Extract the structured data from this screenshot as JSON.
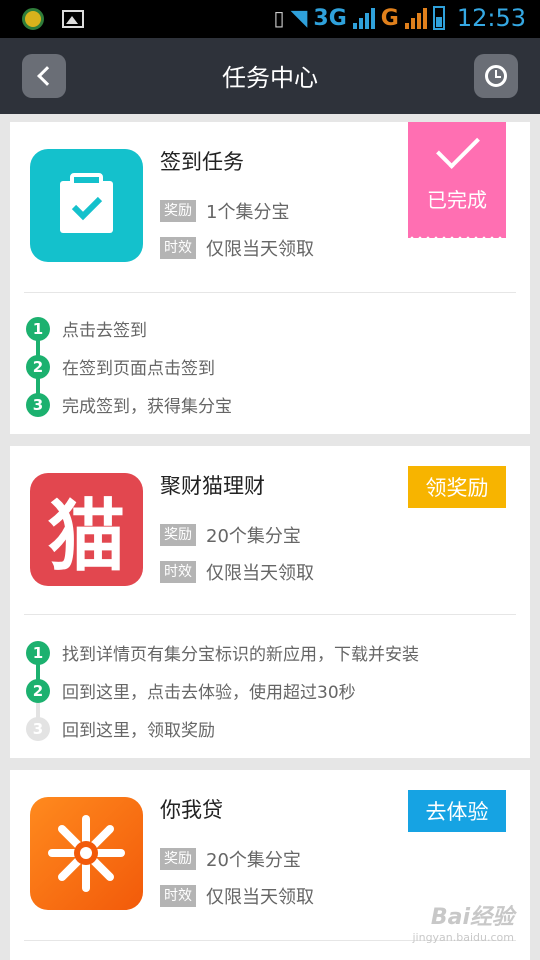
{
  "statusbar": {
    "network_3g": "3G",
    "network_g": "G",
    "time": "12:53"
  },
  "header": {
    "title": "任务中心"
  },
  "cards": [
    {
      "name": "签到任务",
      "reward_tag": "奖励",
      "reward": "1个集分宝",
      "time_tag": "时效",
      "time_limit": "仅限当天领取",
      "status": "已完成",
      "steps": [
        {
          "num": "1",
          "text": "点击去签到"
        },
        {
          "num": "2",
          "text": "在签到页面点击签到"
        },
        {
          "num": "3",
          "text": "完成签到，获得集分宝"
        }
      ]
    },
    {
      "name": "聚财猫理财",
      "reward_tag": "奖励",
      "reward": "20个集分宝",
      "time_tag": "时效",
      "time_limit": "仅限当天领取",
      "button": "领奖励",
      "icon_glyph": "猫",
      "steps": [
        {
          "num": "1",
          "text": "找到详情页有集分宝标识的新应用，下载并安装"
        },
        {
          "num": "2",
          "text": "回到这里，点击去体验，使用超过30秒"
        },
        {
          "num": "3",
          "text": "回到这里，领取奖励"
        }
      ]
    },
    {
      "name": "你我贷",
      "reward_tag": "奖励",
      "reward": "20个集分宝",
      "time_tag": "时效",
      "time_limit": "仅限当天领取",
      "button": "去体验"
    }
  ],
  "watermark": {
    "main": "Bai经验",
    "sub": "jingyan.baidu.com"
  },
  "colors": {
    "done": "#ff6fb2",
    "claim": "#f7b400",
    "try": "#16a3e3",
    "step_active": "#1cb16f"
  }
}
